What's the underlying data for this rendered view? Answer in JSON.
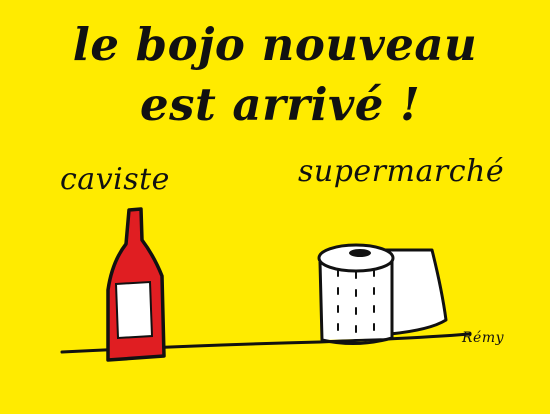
{
  "headline": {
    "line1": "le bojo nouveau",
    "line2": "est arrivé !"
  },
  "labels": {
    "left": "caviste",
    "right": "supermarché"
  },
  "signature": "Rémy",
  "colors": {
    "background": "#ffeb00",
    "ink": "#111111",
    "bottle": "#e01e22",
    "paper": "#ffffff"
  }
}
